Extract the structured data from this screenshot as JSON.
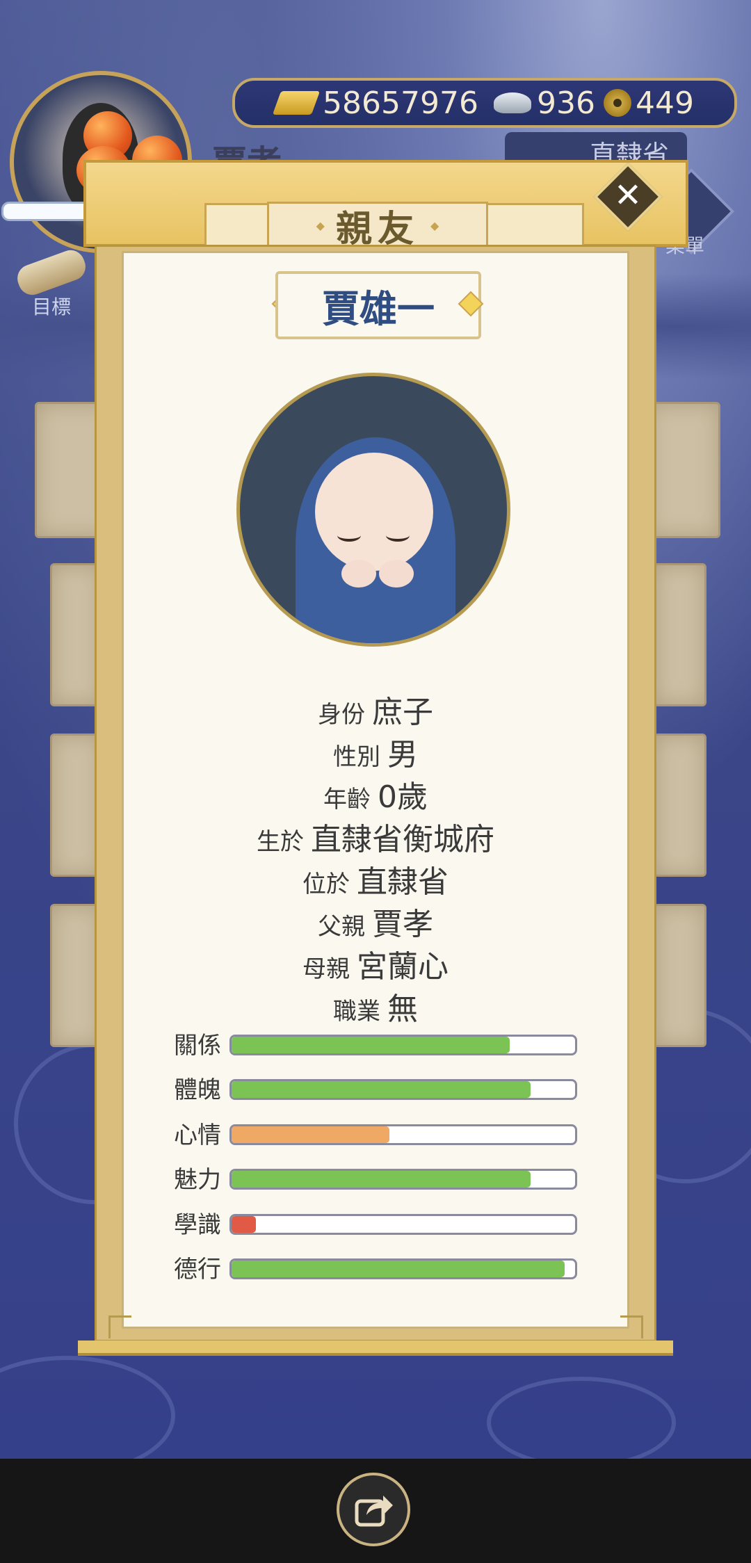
{
  "hud": {
    "gold": "58657976",
    "silver": "936",
    "coins": "449",
    "player_name": "賈孝",
    "region": "直隸省",
    "menu_label": "菜單",
    "target_label": "目標"
  },
  "modal": {
    "title": "親友",
    "name": "賈雄一",
    "info": [
      {
        "key": "身份",
        "value": "庶子"
      },
      {
        "key": "性別",
        "value": "男"
      },
      {
        "key": "年齡",
        "value": "0歲"
      },
      {
        "key": "生於",
        "value": "直隸省衡城府"
      },
      {
        "key": "位於",
        "value": "直隸省"
      },
      {
        "key": "父親",
        "value": "賈孝"
      },
      {
        "key": "母親",
        "value": "宮蘭心"
      },
      {
        "key": "職業",
        "value": "無"
      }
    ],
    "stats": [
      {
        "label": "關係",
        "value": 0.81,
        "color": "#7cc355"
      },
      {
        "label": "體魄",
        "value": 0.87,
        "color": "#7cc355"
      },
      {
        "label": "心情",
        "value": 0.46,
        "color": "#f0a865"
      },
      {
        "label": "魅力",
        "value": 0.87,
        "color": "#7cc355"
      },
      {
        "label": "學識",
        "value": 0.07,
        "color": "#e05a45"
      },
      {
        "label": "德行",
        "value": 0.97,
        "color": "#7cc355"
      }
    ]
  },
  "icons": {
    "close": "close-icon",
    "share": "share-icon",
    "gold": "gold-ingot-icon",
    "silver": "silver-ingot-icon",
    "coin": "coin-icon"
  }
}
